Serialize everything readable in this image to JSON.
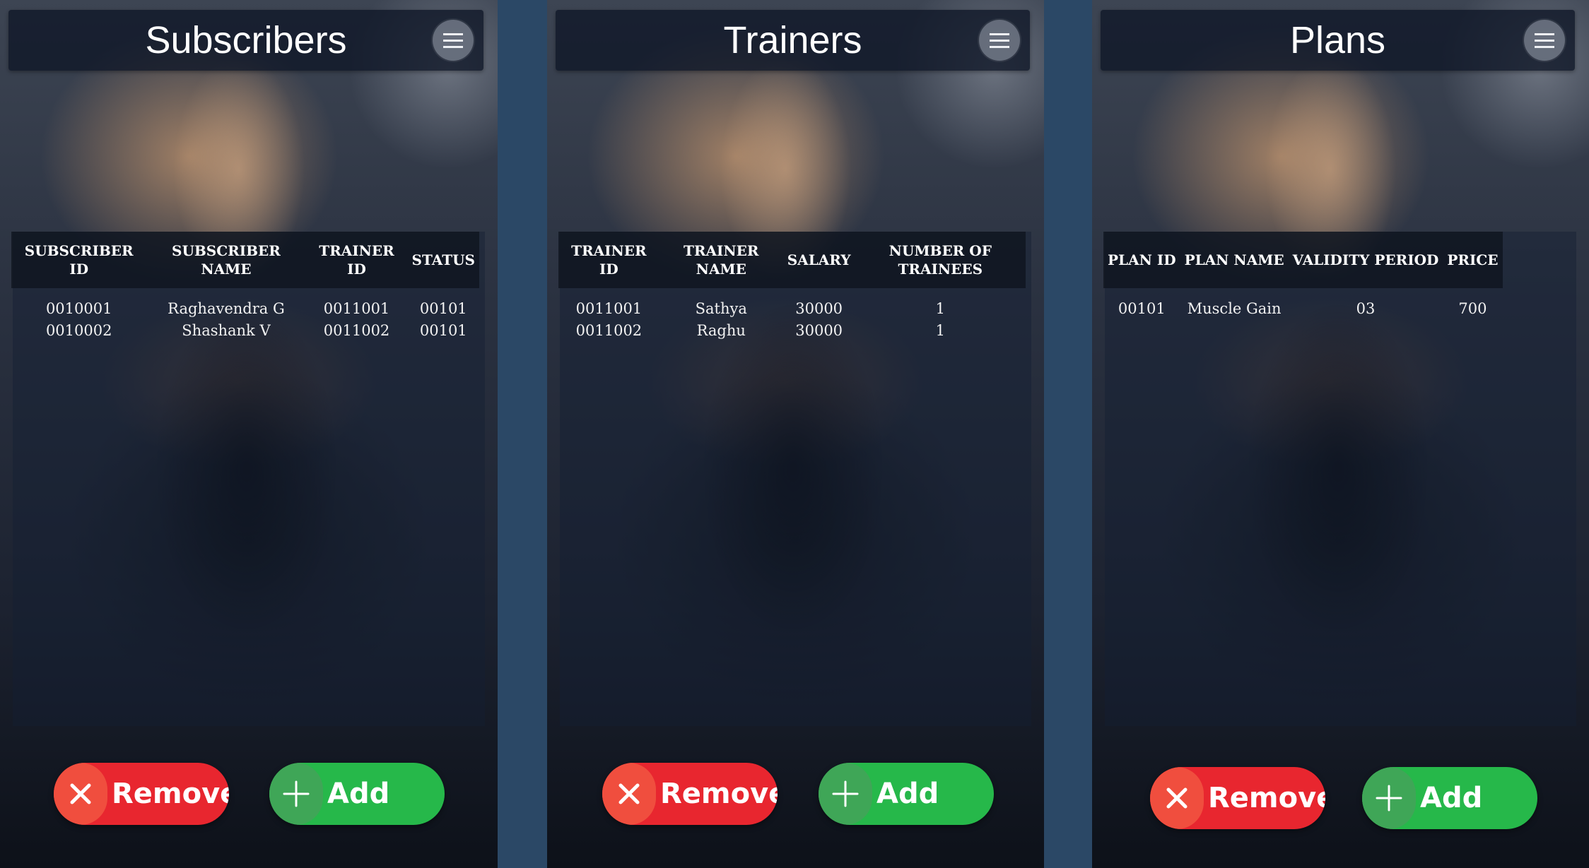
{
  "screens": [
    {
      "title": "Subscribers",
      "columns": [
        "SUBSCRIBER ID",
        "SUBSCRIBER NAME",
        "TRAINER ID",
        "STATUS"
      ],
      "rows": [
        [
          "0010001",
          "Raghavendra G",
          "0011001",
          "00101"
        ],
        [
          "0010002",
          "Shashank V",
          "0011002",
          "00101"
        ]
      ],
      "remove_label": "Remove",
      "add_label": "Add"
    },
    {
      "title": "Trainers",
      "columns": [
        "TRAINER ID",
        "TRAINER NAME",
        "SALARY",
        "NUMBER OF TRAINEES"
      ],
      "rows": [
        [
          "0011001",
          "Sathya",
          "30000",
          "1"
        ],
        [
          "0011002",
          "Raghu",
          "30000",
          "1"
        ]
      ],
      "remove_label": "Remove",
      "add_label": "Add"
    },
    {
      "title": "Plans",
      "columns": [
        "PLAN ID",
        "PLAN NAME",
        "VALIDITY PERIOD",
        "PRICE"
      ],
      "rows": [
        [
          "00101",
          "Muscle Gain",
          "03",
          "700"
        ]
      ],
      "remove_label": "Remove",
      "add_label": "Add"
    }
  ],
  "icons": {
    "menu": "hamburger-menu-icon",
    "remove": "close-x-icon",
    "add": "plus-icon"
  },
  "colors": {
    "page_background": "#2b4866",
    "header_bar": "#0e1626",
    "remove_button": "#e8262f",
    "add_button": "#26b84a"
  }
}
